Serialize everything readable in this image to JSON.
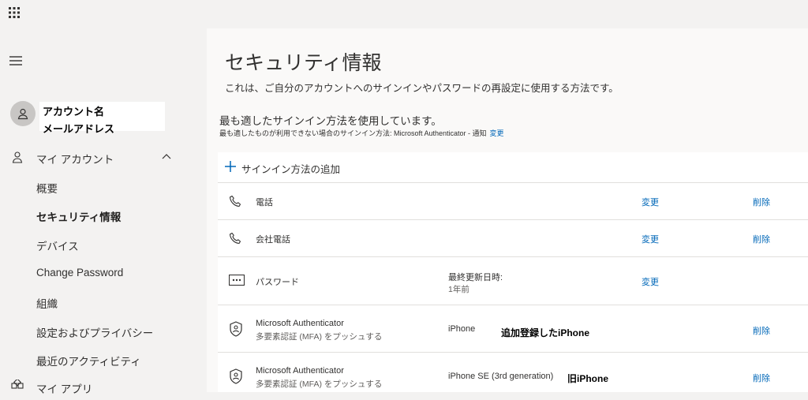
{
  "topbar": {
    "icon": "waffle-icon"
  },
  "sidebar": {
    "account_name": "アカウント名",
    "account_email": "メールアドレス",
    "section_label": "マイ アカウント",
    "items": [
      {
        "label": "概要"
      },
      {
        "label": "セキュリティ情報"
      },
      {
        "label": "デバイス"
      },
      {
        "label": "Change Password"
      },
      {
        "label": "組織"
      },
      {
        "label": "設定およびプライバシー"
      },
      {
        "label": "最近のアクティビティ"
      }
    ],
    "active_index": 1,
    "my_apps_label": "マイ アプリ"
  },
  "main": {
    "title": "セキュリティ情報",
    "description": "これは、ご自分のアカウントへのサインインやパスワードの再設定に使用する方法です。",
    "default_method_message": "最も適したサインイン方法を使用しています。",
    "default_method_sub": "最も適したものが利用できない場合のサインイン方法: Microsoft Authenticator - 通知",
    "default_method_change": "変更",
    "add_method_label": "サインイン方法の追加",
    "methods": [
      {
        "icon": "phone-icon",
        "name": "電話",
        "change": "変更",
        "delete": "削除"
      },
      {
        "icon": "phone-icon",
        "name": "会社電話",
        "change": "変更",
        "delete": "削除"
      },
      {
        "icon": "password-icon",
        "name": "パスワード",
        "detail": "最終更新日時:",
        "detail2": "1年前",
        "change": "変更"
      },
      {
        "icon": "authenticator-icon",
        "name": "Microsoft Authenticator",
        "sub": "多要素認証 (MFA) をプッシュする",
        "detail": "iPhone",
        "note": "追加登録したiPhone",
        "delete": "削除"
      },
      {
        "icon": "authenticator-icon",
        "name": "Microsoft Authenticator",
        "sub": "多要素認証 (MFA) をプッシュする",
        "detail": "iPhone SE (3rd generation)",
        "note": "旧iPhone",
        "delete": "削除"
      }
    ]
  },
  "colors": {
    "link": "#0067b8",
    "sidebar_bg": "#f3f2f1",
    "card_bg": "#ffffff"
  }
}
